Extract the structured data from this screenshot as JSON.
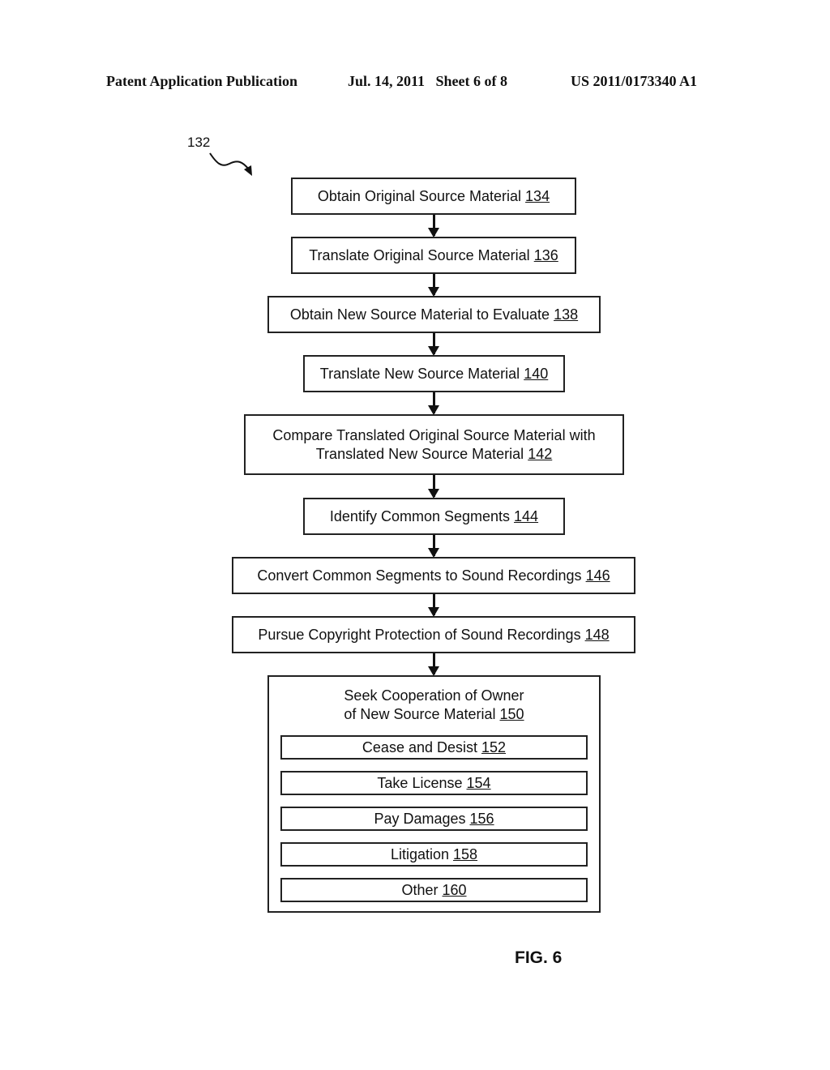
{
  "header": {
    "publication": "Patent Application Publication",
    "date_sheet": "Jul. 14, 2011   Sheet 6 of 8",
    "patent_number": "US 2011/0173340 A1"
  },
  "diagram_ref": "132",
  "steps": [
    {
      "label": "Obtain Original Source Material",
      "num": "134"
    },
    {
      "label": "Translate Original Source Material",
      "num": "136"
    },
    {
      "label": "Obtain New Source Material to Evaluate",
      "num": "138"
    },
    {
      "label": "Translate New Source Material",
      "num": "140"
    },
    {
      "label_line1": "Compare Translated Original Source Material with",
      "label": "Translated New Source Material",
      "num": "142"
    },
    {
      "label": "Identify Common Segments",
      "num": "144"
    },
    {
      "label": "Convert Common Segments to Sound Recordings",
      "num": "146"
    },
    {
      "label": "Pursue Copyright Protection of Sound Recordings",
      "num": "148"
    }
  ],
  "final_step": {
    "label_line1": "Seek Cooperation of Owner",
    "label": "of New Source Material",
    "num": "150",
    "options": [
      {
        "label": "Cease and Desist",
        "num": "152"
      },
      {
        "label": "Take License",
        "num": "154"
      },
      {
        "label": "Pay Damages",
        "num": "156"
      },
      {
        "label": "Litigation",
        "num": "158"
      },
      {
        "label": "Other",
        "num": "160"
      }
    ]
  },
  "figure_label": "FIG. 6"
}
